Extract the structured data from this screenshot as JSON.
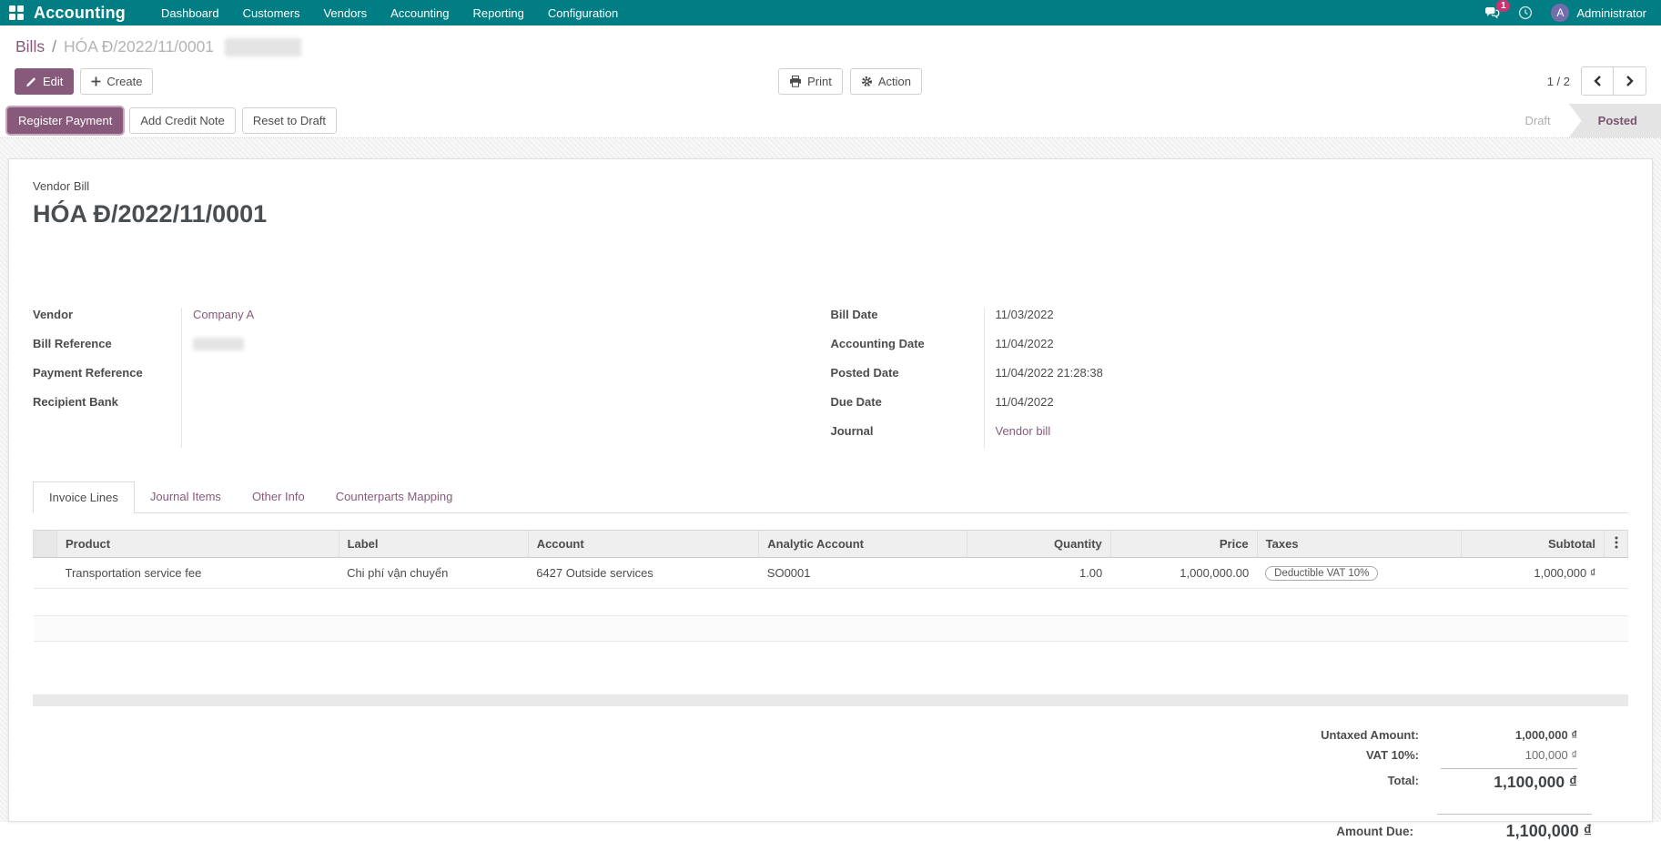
{
  "navbar": {
    "app_name": "Accounting",
    "menu": [
      "Dashboard",
      "Customers",
      "Vendors",
      "Accounting",
      "Reporting",
      "Configuration"
    ],
    "messages_badge": "1",
    "user_initial": "A",
    "user_name": "Administrator"
  },
  "breadcrumb": {
    "parent": "Bills",
    "separator": "/",
    "current": "HÓA Đ/2022/11/0001"
  },
  "control_panel": {
    "edit_label": "Edit",
    "create_label": "Create",
    "print_label": "Print",
    "action_label": "Action",
    "pager_value": "1 / 2"
  },
  "statusbar": {
    "register_payment_label": "Register Payment",
    "add_credit_note_label": "Add Credit Note",
    "reset_to_draft_label": "Reset to Draft",
    "state_draft": "Draft",
    "state_posted": "Posted"
  },
  "document": {
    "type_label": "Vendor Bill",
    "title": "HÓA Đ/2022/11/0001",
    "fields_left": [
      {
        "label": "Vendor",
        "value": "Company A"
      },
      {
        "label": "Bill Reference",
        "value": ""
      },
      {
        "label": "Payment Reference",
        "value": ""
      },
      {
        "label": "Recipient Bank",
        "value": ""
      }
    ],
    "fields_right": [
      {
        "label": "Bill Date",
        "value": "11/03/2022"
      },
      {
        "label": "Accounting Date",
        "value": "11/04/2022"
      },
      {
        "label": "Posted Date",
        "value": "11/04/2022 21:28:38"
      },
      {
        "label": "Due Date",
        "value": "11/04/2022"
      },
      {
        "label": "Journal",
        "value": "Vendor bill"
      }
    ],
    "tabs": [
      {
        "label": "Invoice Lines"
      },
      {
        "label": "Journal Items"
      },
      {
        "label": "Other Info"
      },
      {
        "label": "Counterparts Mapping"
      }
    ],
    "lines_table": {
      "headers": {
        "product": "Product",
        "label": "Label",
        "account": "Account",
        "analytic_account": "Analytic Account",
        "quantity": "Quantity",
        "price": "Price",
        "taxes": "Taxes",
        "subtotal": "Subtotal"
      },
      "rows": [
        {
          "product": "Transportation service fee",
          "label": "Chi phí vận chuyển",
          "account": "6427 Outside services",
          "analytic_account": "SO0001",
          "quantity": "1.00",
          "price": "1,000,000.00",
          "taxes": "Deductible VAT 10%",
          "subtotal": "1,000,000 ₫"
        }
      ]
    },
    "totals": {
      "untaxed_label": "Untaxed Amount:",
      "untaxed_value": "1,000,000 ₫",
      "vat_label": "VAT 10%:",
      "vat_value": "100,000 ₫",
      "total_label": "Total:",
      "total_value": "1,100,000 ₫",
      "amount_due_label": "Amount Due:",
      "amount_due_value": "1,100,000 ₫"
    }
  },
  "colors": {
    "navbar_teal": "#017e84",
    "brand_purple": "#875A7B",
    "badge_pink": "#ca3472",
    "avatar_purple": "#736dab",
    "posted_text": "#7c5271"
  }
}
